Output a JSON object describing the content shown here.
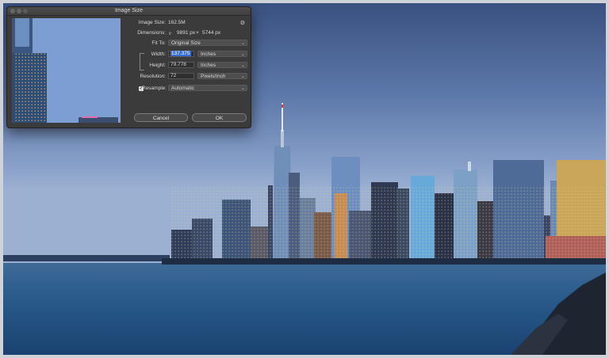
{
  "dialog": {
    "title": "Image Size",
    "image_size_label": "Image Size:",
    "image_size_value": "162.5M",
    "dimensions_label": "Dimensions:",
    "dimensions_width": "9891 px",
    "dimensions_x": "×",
    "dimensions_height": "5744 px",
    "fit_to_label": "Fit To:",
    "fit_to_value": "Original Size",
    "width_label": "Width:",
    "width_value": "137.375",
    "width_unit": "Inches",
    "height_label": "Height:",
    "height_value": "79.778",
    "height_unit": "Inches",
    "resolution_label": "Resolution:",
    "resolution_value": "72",
    "resolution_unit": "Pixels/Inch",
    "resample_label": "Resample:",
    "resample_checked": true,
    "resample_value": "Automatic",
    "cancel_label": "Cancel",
    "ok_label": "OK"
  },
  "icons": {
    "gear": "gear-icon",
    "chevron": "chevron-down-icon",
    "link": "link-icon",
    "checkbox": "checkmark-icon"
  },
  "colors": {
    "dialog_bg": "#3b3b3b",
    "selection": "#3a6fd0",
    "sky": "#7e97c2",
    "water": "#1d4a76"
  }
}
